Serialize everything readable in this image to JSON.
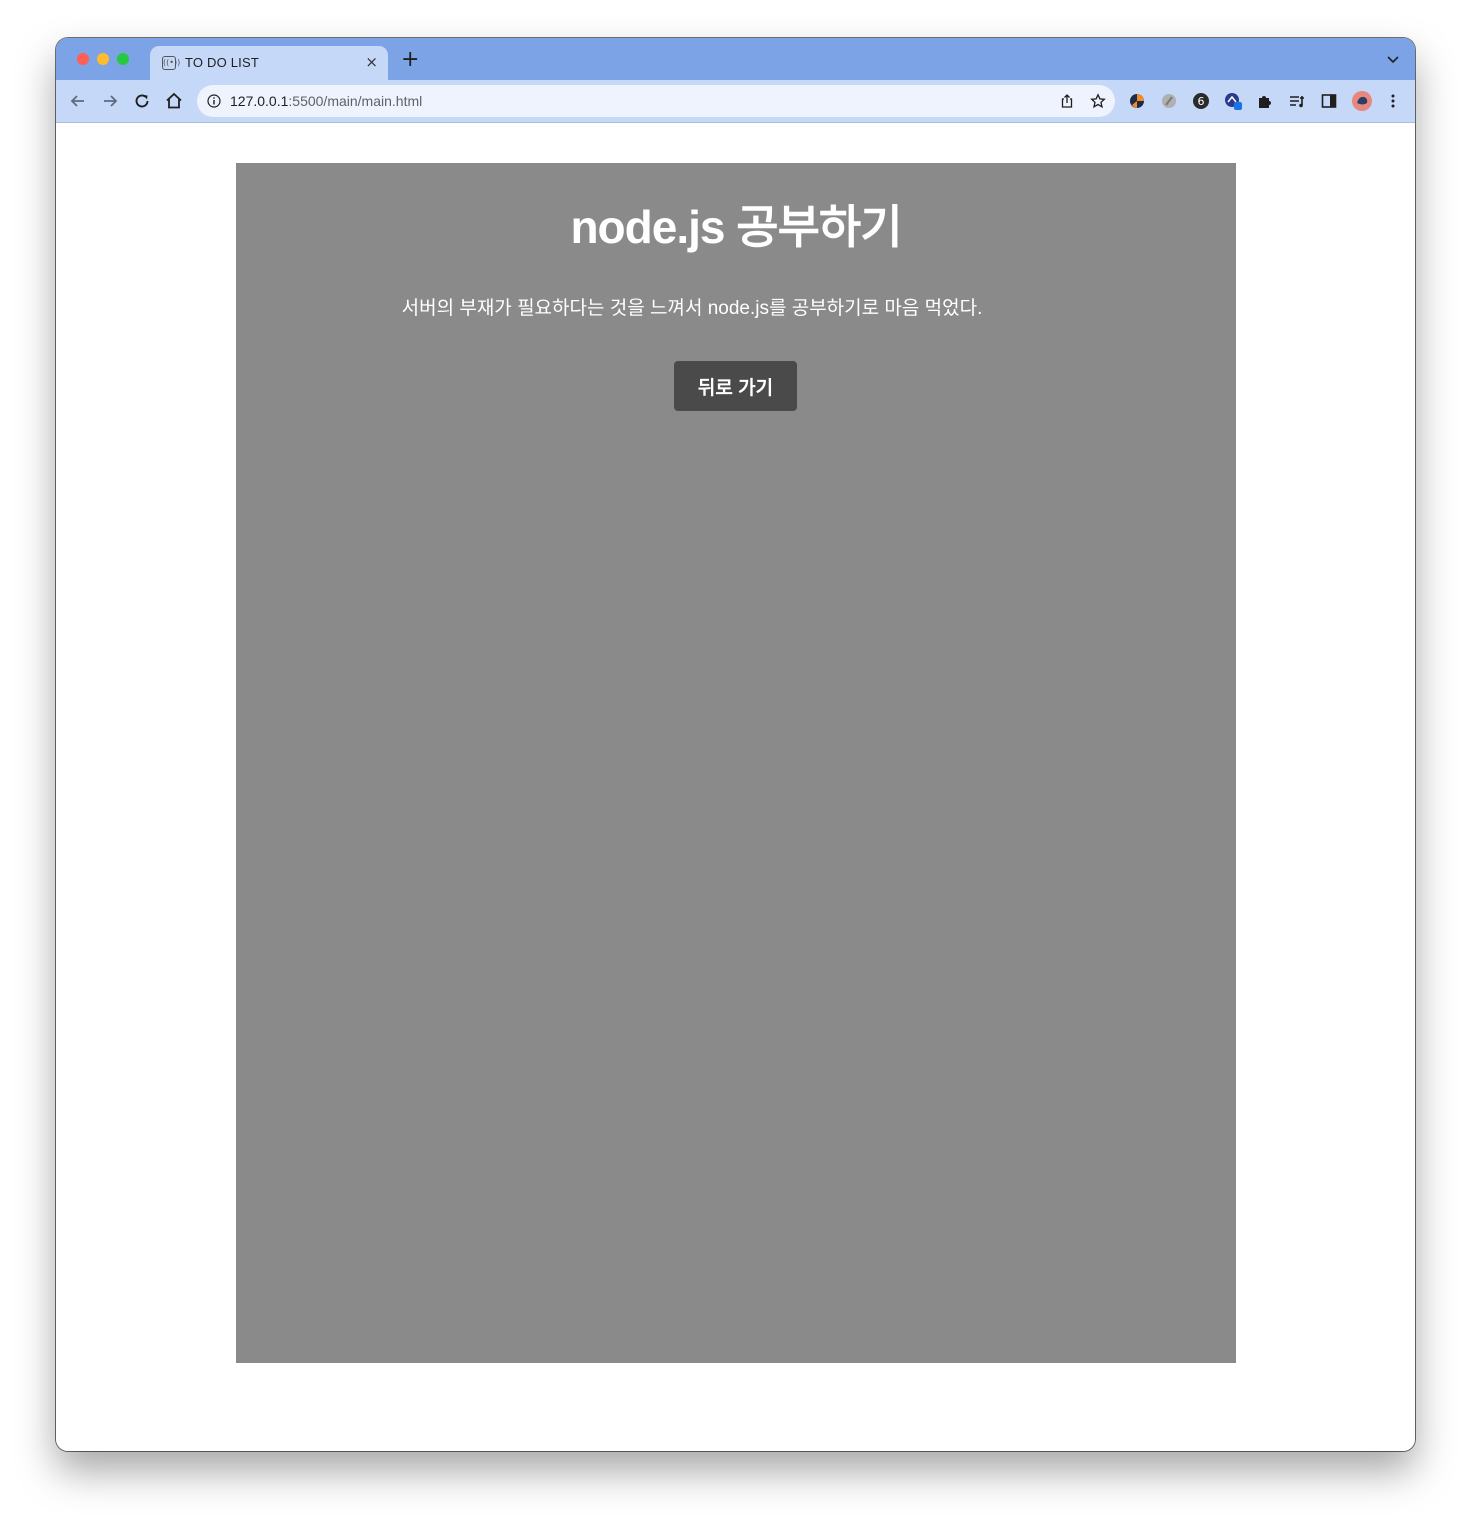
{
  "browser": {
    "tab": {
      "title": "TO DO LIST",
      "favicon": "broadcast-icon",
      "close": "×"
    },
    "new_tab": "+",
    "address": {
      "host": "127.0.0.1",
      "path": ":5500/main/main.html"
    },
    "extensions": [
      "extension-orange-icon",
      "extension-grey-icon",
      "extension-6-icon",
      "extension-blue-icon",
      "puzzle-icon",
      "reading-list-icon",
      "side-panel-icon",
      "profile-avatar",
      "kebab-menu-icon"
    ],
    "colors": {
      "tabbar": "#7ba3e6",
      "toolbar": "#c5d8f7"
    }
  },
  "page": {
    "title": "node.js 공부하기",
    "description": "서버의 부재가 필요하다는 것을 느껴서 node.js를 공부하기로 마음 먹었다.",
    "back_button": "뒤로 가기",
    "colors": {
      "card": "#8a8a8a",
      "button": "#4a4a4a"
    }
  }
}
